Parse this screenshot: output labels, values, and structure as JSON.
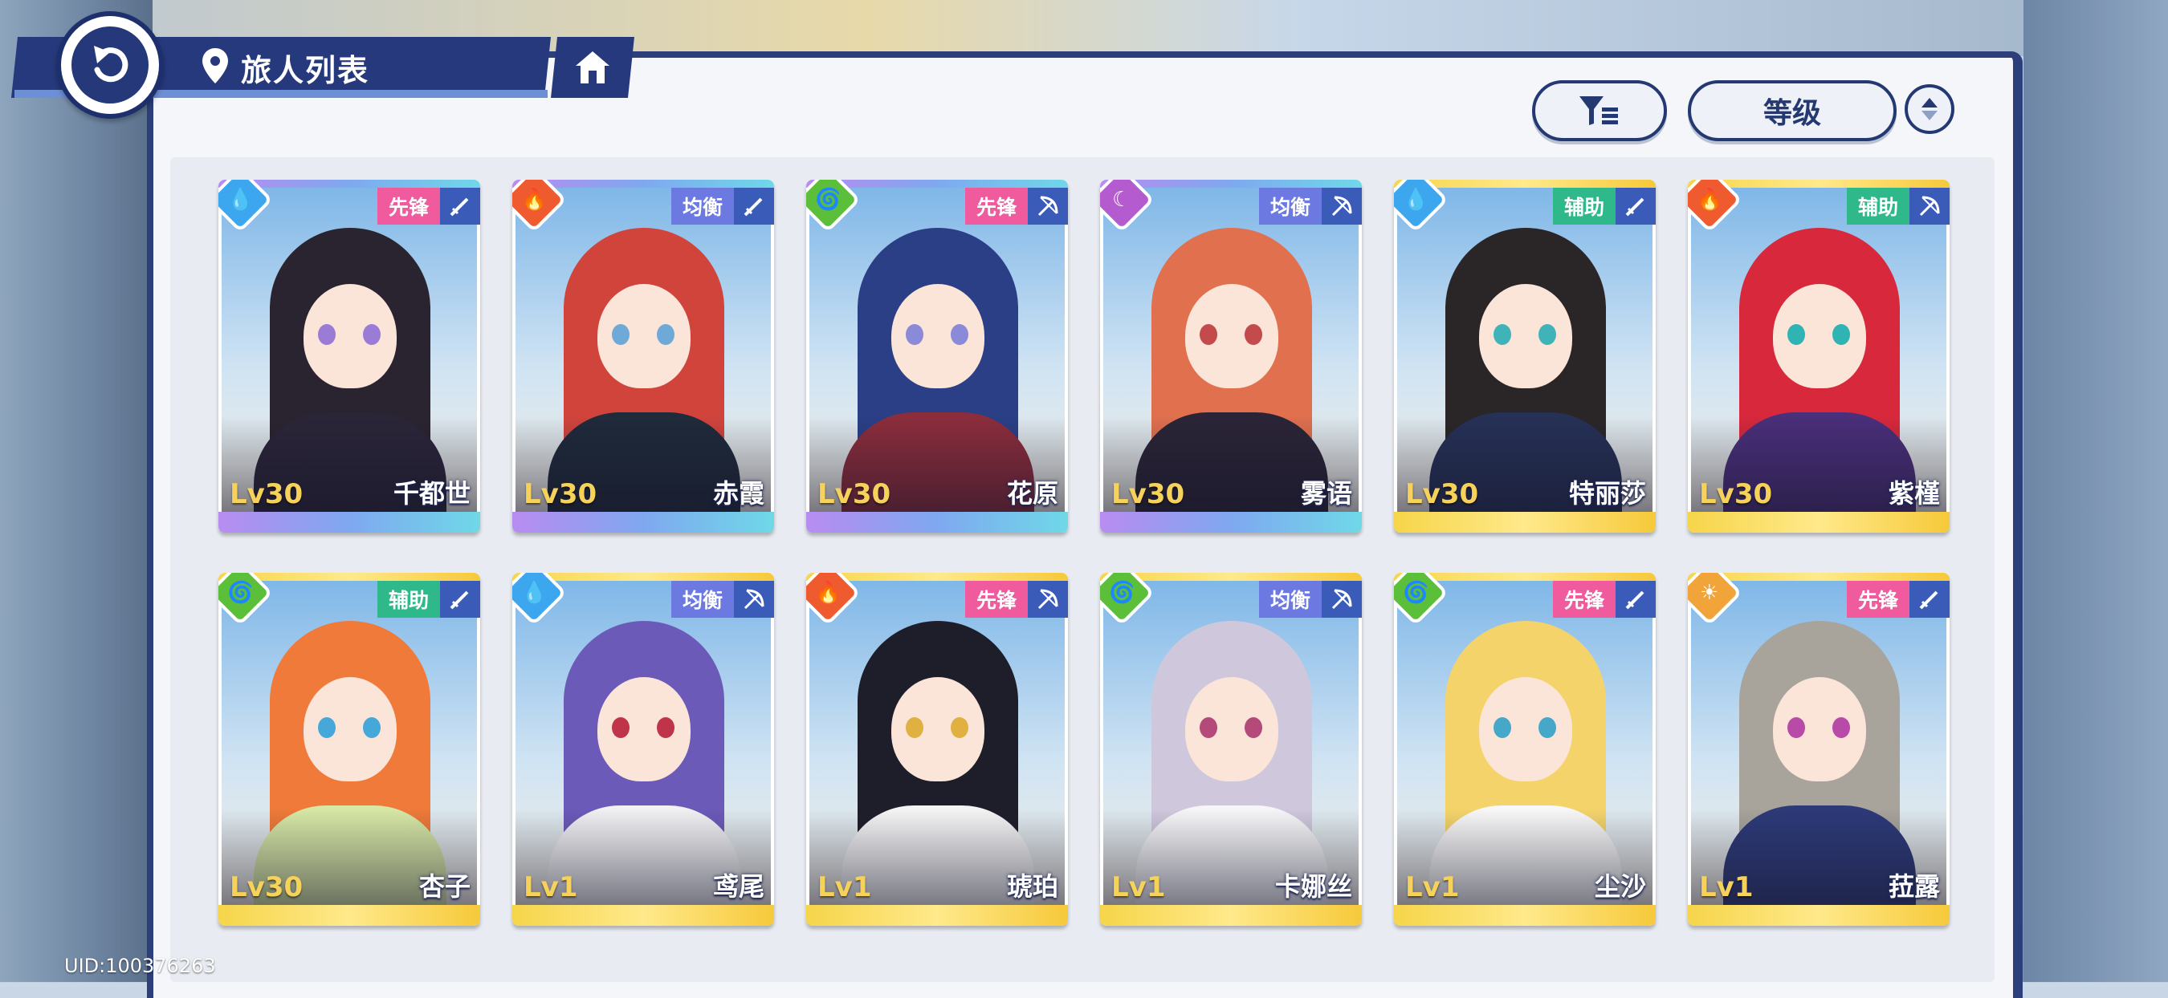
{
  "header": {
    "title": "旅人列表"
  },
  "controls": {
    "sort_label": "等级"
  },
  "footer": {
    "uid": "UID:100376263"
  },
  "colors": {
    "pioneer": "#ef5b9c",
    "balance": "#6c79e0",
    "support": "#2fb88a",
    "water": "#3ca6ee",
    "fire": "#ef5b2e",
    "wind": "#5cbf3a",
    "dark": "#b45ccf",
    "light": "#f0a43a"
  },
  "characters": [
    {
      "name": "千都世",
      "level": "Lv30",
      "role": "先锋",
      "element": "water",
      "weapon": "sword",
      "rarity": "purple",
      "hair": "#2a2430",
      "eyes": "#9a7bd6",
      "outfit": "#2b2538"
    },
    {
      "name": "赤霞",
      "level": "Lv30",
      "role": "均衡",
      "element": "fire",
      "weapon": "sword",
      "rarity": "purple",
      "hair": "#d1443c",
      "eyes": "#6fa9d8",
      "outfit": "#1f2a3a"
    },
    {
      "name": "花原",
      "level": "Lv30",
      "role": "先锋",
      "element": "wind",
      "weapon": "bow",
      "rarity": "purple",
      "hair": "#2a3f86",
      "eyes": "#8a8ad8",
      "outfit": "#8c2d3c"
    },
    {
      "name": "雾语",
      "level": "Lv30",
      "role": "均衡",
      "element": "dark",
      "weapon": "bow",
      "rarity": "purple",
      "hair": "#e0704e",
      "eyes": "#c44b4b",
      "outfit": "#2a2436"
    },
    {
      "name": "特丽莎",
      "level": "Lv30",
      "role": "辅助",
      "element": "water",
      "weapon": "sword",
      "rarity": "gold",
      "hair": "#2a2628",
      "eyes": "#3fb3b8",
      "outfit": "#263156"
    },
    {
      "name": "紫槿",
      "level": "Lv30",
      "role": "辅助",
      "element": "fire",
      "weapon": "bow",
      "rarity": "gold",
      "hair": "#d8283c",
      "eyes": "#2fb3b3",
      "outfit": "#4a2f7a"
    },
    {
      "name": "杏子",
      "level": "Lv30",
      "role": "辅助",
      "element": "wind",
      "weapon": "sword",
      "rarity": "gold",
      "hair": "#ef7a3a",
      "eyes": "#46a8d8",
      "outfit": "#d7e7a5"
    },
    {
      "name": "鸢尾",
      "level": "Lv1",
      "role": "均衡",
      "element": "water",
      "weapon": "bow",
      "rarity": "gold",
      "hair": "#6b5ab8",
      "eyes": "#c0344a",
      "outfit": "#f1f1f3"
    },
    {
      "name": "琥珀",
      "level": "Lv1",
      "role": "先锋",
      "element": "fire",
      "weapon": "bow",
      "rarity": "gold",
      "hair": "#1e1e2a",
      "eyes": "#e0b040",
      "outfit": "#f4f4f4"
    },
    {
      "name": "卡娜丝",
      "level": "Lv1",
      "role": "均衡",
      "element": "wind",
      "weapon": "bow",
      "rarity": "gold",
      "hair": "#cfc8dc",
      "eyes": "#b44a7a",
      "outfit": "#f6f6f8"
    },
    {
      "name": "尘沙",
      "level": "Lv1",
      "role": "先锋",
      "element": "wind",
      "weapon": "sword",
      "rarity": "gold",
      "hair": "#f4d46a",
      "eyes": "#46a8c8",
      "outfit": "#f8f8f8"
    },
    {
      "name": "菈露",
      "level": "Lv1",
      "role": "先锋",
      "element": "light",
      "weapon": "sword",
      "rarity": "gold",
      "hair": "#a8a49c",
      "eyes": "#b84aa8",
      "outfit": "#2d3a78"
    }
  ]
}
